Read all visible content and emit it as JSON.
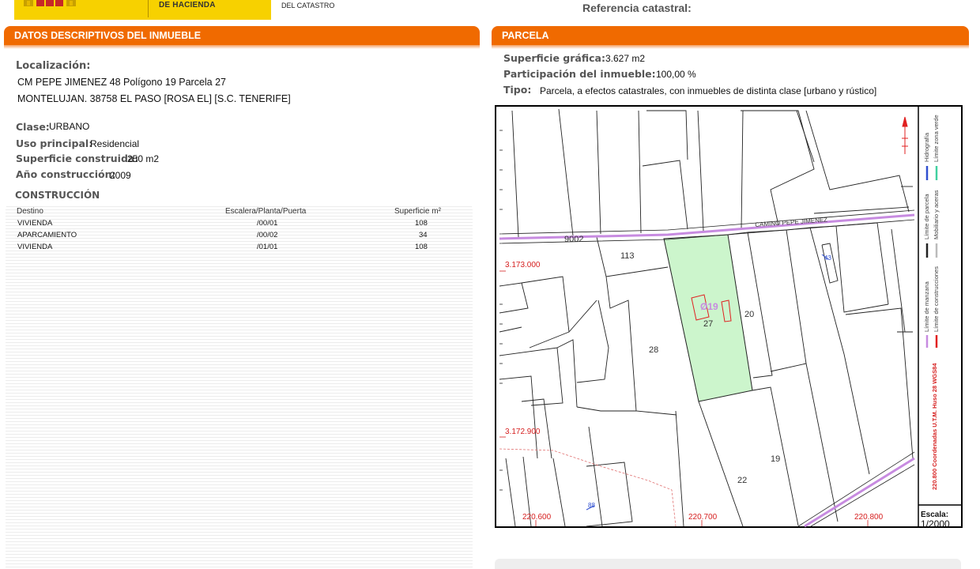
{
  "header": {
    "ministry_line": "DE HACIENDA",
    "office_line": "DEL CATASTRO",
    "reference_label": "Referencia catastral:"
  },
  "inmueble": {
    "section_title": "DATOS DESCRIPTIVOS DEL INMUEBLE",
    "localizacion_label": "Localización:",
    "address_line1": "CM PEPE JIMENEZ 48 Polígono 19 Parcela 27",
    "address_line2": "MONTELUJAN. 38758 EL PASO [ROSA EL] [S.C. TENERIFE]",
    "clase_label": "Clase:",
    "clase_value": "URBANO",
    "uso_label": "Uso principal:",
    "uso_value": "Residencial",
    "superficie_label": "Superficie construida:",
    "superficie_value": "250 m2",
    "anio_label": "Año construcción:",
    "anio_value": "2009"
  },
  "construccion": {
    "title": "CONSTRUCCIÓN",
    "headers": [
      "Destino",
      "Escalera/Planta/Puerta",
      "Superficie m²"
    ],
    "rows": [
      [
        "VIVIENDA",
        "/00/01",
        "108"
      ],
      [
        "APARCAMIENTO",
        "/00/02",
        "34"
      ],
      [
        "VIVIENDA",
        "/01/01",
        "108"
      ]
    ]
  },
  "parcela": {
    "section_title": "PARCELA",
    "superficie_label": "Superficie gráfica:",
    "superficie_value": "3.627 m2",
    "participacion_label": "Participación del inmueble:",
    "participacion_value": "100,00 %",
    "tipo_label": "Tipo:",
    "tipo_value": "Parcela, a efectos catastrales, con inmuebles de distinta clase [urbano y rústico]"
  },
  "map": {
    "road_number": "9002",
    "road_name": "CAMINO PEPE JIMENEZ",
    "parcel_numbers": {
      "p113": "113",
      "p28": "28",
      "p27": "27",
      "p20": "20",
      "p19": "19",
      "p22": "22"
    },
    "building_code": "Ø19",
    "house_number_a": "43",
    "house_number_b": "88",
    "y_coords": [
      "3.173.000",
      "3.172.900"
    ],
    "x_coords": [
      "220.600",
      "220.700",
      "220.800"
    ],
    "legend": {
      "hidrografia": "Hidrografía",
      "zona_verde": "Límite zona verde",
      "parcela": "Límite de parcela",
      "mobiliario": "Mobiliario y aceras",
      "manzana": "Límite de manzana",
      "construcciones": "Límite de construcciones"
    },
    "coordinate_note": "220.800 Coordenadas U.T.M. Huso 28 WGS84",
    "scale_label": "Escala:",
    "scale_value": "1/2000",
    "colors": {
      "selected_parcel": "#ccf5cc",
      "road_line": "#c78be0",
      "construction_line": "#e02020",
      "coordinate_text": "#d62020",
      "hydro_line": "#3050d0",
      "green_zone_line": "#40d0a0"
    }
  },
  "theme": {
    "accent": "#f06a00",
    "header_yellow": "#f7d100"
  }
}
